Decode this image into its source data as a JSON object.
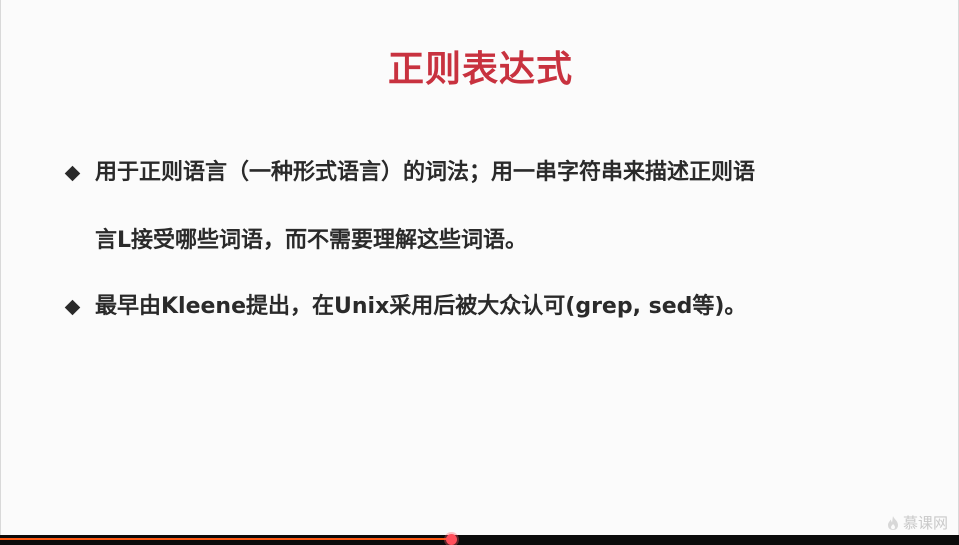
{
  "slide": {
    "title": "正则表达式",
    "bullets": [
      {
        "lines": [
          "用于正则语言（一种形式语言）的词法；用一串字符串来描述正则语",
          "言L接受哪些词语，而不需要理解这些词语。"
        ]
      },
      {
        "lines": [
          "最早由Kleene提出，在Unix采用后被大众认可(grep, sed等)。"
        ]
      }
    ],
    "title_color": "#c8323f",
    "text_color": "#2a2a2a"
  },
  "player": {
    "progress": 0.47,
    "progress_color": "#ff5a14",
    "watermark_icon": "flame-icon",
    "watermark_text": "慕课网"
  }
}
